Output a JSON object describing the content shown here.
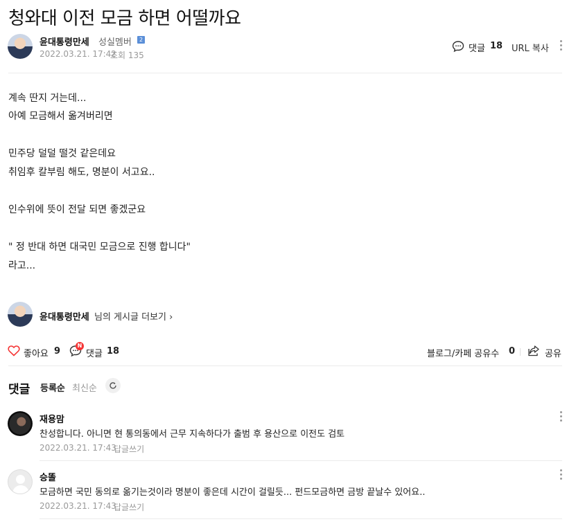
{
  "post": {
    "title": "청와대 이전 모금 하면 어떨까요",
    "author": {
      "name": "윤대통령만세",
      "level": "성실멤버",
      "level_badge": "2"
    },
    "date": "2022.03.21. 17:42",
    "views": "조회 135",
    "header_comments_label": "댓글",
    "header_comments_count": "18",
    "url_copy": "URL 복사",
    "body_lines": [
      "계속 딴지 거는데...",
      "아예 모금해서 옮겨버리면",
      "민주당 덜덜 떨것 같은데요",
      "취임후 칼부림 해도, 명분이 서고요..",
      "인수위에 뜻이 전달 되면 좋겠군요",
      "\" 정 반대 하면 대국민 모금으로 진행 합니다\"",
      "라고..."
    ],
    "more_posts": {
      "name": "윤대통령만세",
      "suffix": "님의 게시글 더보기 ›"
    },
    "actions": {
      "like_label": "좋아요",
      "like_count": "9",
      "comment_label": "댓글",
      "comment_count": "18",
      "new_badge": "N",
      "share_count_label": "블로그/카페 공유수",
      "share_count": "0",
      "share_label": "공유"
    }
  },
  "comments_section": {
    "title": "댓글",
    "sort_registered": "등록순",
    "sort_latest": "최신순",
    "comments": [
      {
        "author": "재용맘",
        "text": "찬성합니다. 아니면 현 통의동에서 근무 지속하다가 출범 후 용산으로 이전도 검토",
        "date": "2022.03.21. 17:43",
        "reply": "답글쓰기"
      },
      {
        "author": "승똘",
        "text": "모금하면 국민 동의로 옮기는것이라 명분이 좋은데 시간이 걸릴듯... 펀드모금하면 금방 끝날수 있어요..",
        "date": "2022.03.21. 17:43",
        "reply": "답글쓰기"
      }
    ]
  },
  "colors": {
    "accent_red": "#f53535",
    "level_badge": "#5b8fd8",
    "muted": "#999999"
  },
  "icons": [
    "comment-icon",
    "more-vertical-icon",
    "heart-icon",
    "share-icon",
    "refresh-icon",
    "chevron-right-icon"
  ]
}
